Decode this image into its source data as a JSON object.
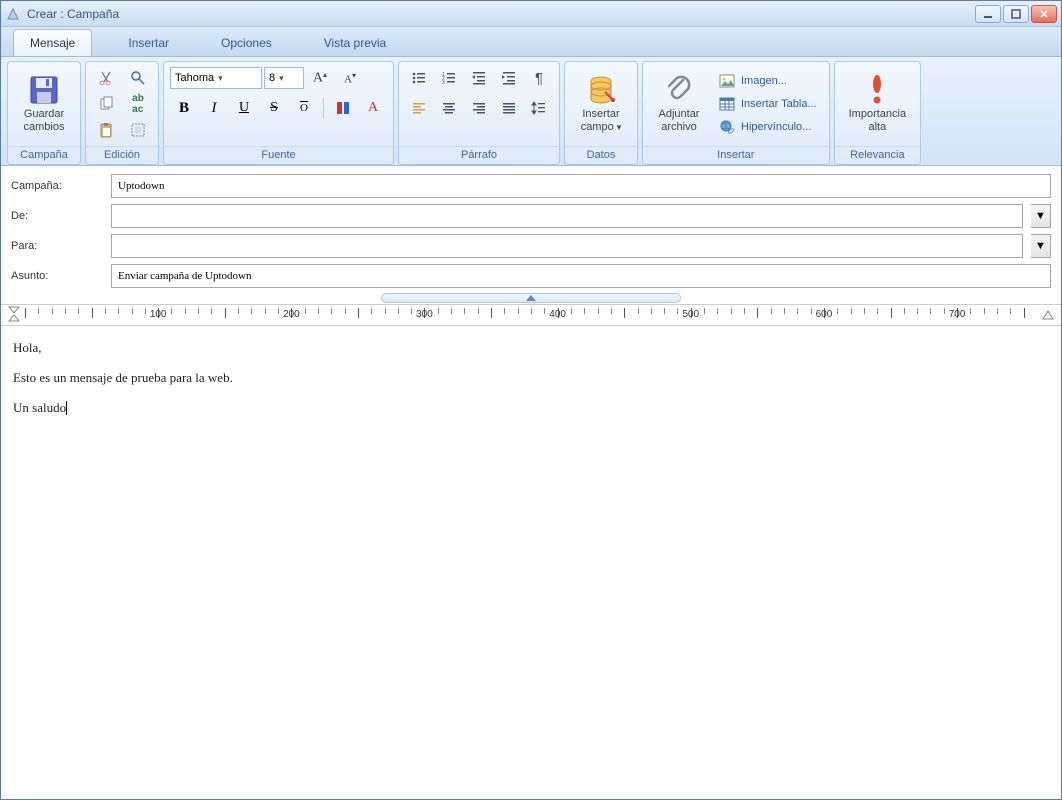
{
  "window": {
    "title": "Crear : Campaña"
  },
  "tabs": {
    "mensaje": "Mensaje",
    "insertar": "Insertar",
    "opciones": "Opciones",
    "vista": "Vista previa"
  },
  "ribbon": {
    "campana": {
      "label": "Campaña",
      "save": "Guardar\ncambios"
    },
    "edicion": {
      "label": "Edición"
    },
    "fuente": {
      "label": "Fuente",
      "font": "Tahoma",
      "size": "8"
    },
    "parrafo": {
      "label": "Párrafo"
    },
    "datos": {
      "label": "Datos",
      "insert_field": "Insertar\ncampo",
      "dropdown_arrow": "▾"
    },
    "insertar": {
      "label": "Insertar",
      "attach": "Adjuntar\narchivo",
      "image": "Imagen...",
      "table": "Insertar Tabla...",
      "link": "Hipervínculo..."
    },
    "relevancia": {
      "label": "Relevancia",
      "importance": "Importancia\nalta"
    }
  },
  "fields": {
    "campana_label": "Campaña:",
    "campana_value": "Uptodown",
    "de_label": "De:",
    "de_value": "",
    "para_label": "Para:",
    "para_value": "",
    "asunto_label": "Asunto:",
    "asunto_value": "Enviar campaña de Uptodown"
  },
  "ruler": {
    "marks": [
      "100",
      "200",
      "300",
      "400",
      "500",
      "600",
      "700"
    ]
  },
  "body": {
    "line1": "Hola,",
    "line2": "Esto es un mensaje de prueba para la web.",
    "line3": "Un saludo"
  }
}
